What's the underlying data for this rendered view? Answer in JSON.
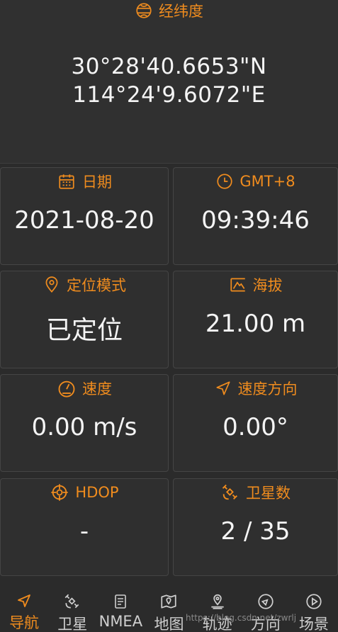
{
  "top": {
    "title": "经纬度",
    "icon": "globe-icon",
    "latitude": "30°28'40.6653\"N",
    "longitude": "114°24'9.6072\"E"
  },
  "tiles": [
    {
      "name": "date",
      "icon": "calendar-icon",
      "label": "日期",
      "value": "2021-08-20"
    },
    {
      "name": "time",
      "icon": "clock-icon",
      "label": "GMT+8",
      "value": "09:39:46"
    },
    {
      "name": "position-mode",
      "icon": "location-pin-icon",
      "label": "定位模式",
      "value": "已定位"
    },
    {
      "name": "altitude",
      "icon": "mountain-icon",
      "label": "海拔",
      "value": "21.00 m"
    },
    {
      "name": "speed",
      "icon": "speedometer-icon",
      "label": "速度",
      "value": "0.00 m/s"
    },
    {
      "name": "heading",
      "icon": "navigation-arrow-icon",
      "label": "速度方向",
      "value": "0.00°"
    },
    {
      "name": "hdop",
      "icon": "crosshair-icon",
      "label": "HDOP",
      "value": "-"
    },
    {
      "name": "satellites",
      "icon": "satellite-icon",
      "label": "卫星数",
      "value": "2 / 35"
    }
  ],
  "tabs": [
    {
      "label": "导航",
      "icon": "navigation-arrow-icon",
      "active": true
    },
    {
      "label": "卫星",
      "icon": "satellite-icon",
      "active": false
    },
    {
      "label": "NMEA",
      "icon": "document-icon",
      "active": false
    },
    {
      "label": "地图",
      "icon": "map-icon",
      "active": false
    },
    {
      "label": "轨迹",
      "icon": "location-pin-icon",
      "active": false
    },
    {
      "label": "方向",
      "icon": "compass-icon",
      "active": false
    },
    {
      "label": "场景",
      "icon": "play-icon",
      "active": false
    }
  ],
  "watermark": "https://blog.csdn.net/zwrlj",
  "colors": {
    "accent": "#f08c1e",
    "background": "#2b2b2b",
    "card": "#2f2f2f",
    "text": "#f4f4f4"
  }
}
